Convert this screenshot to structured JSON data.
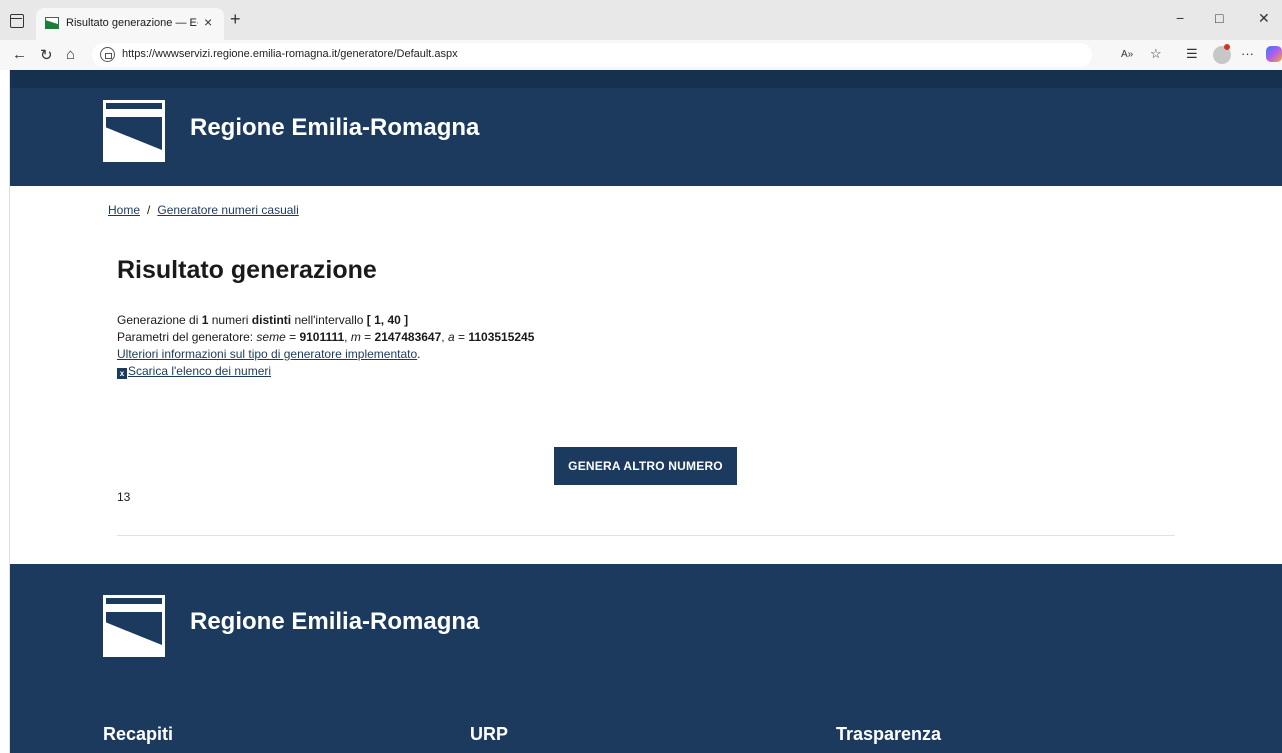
{
  "browser": {
    "tab_title": "Risultato generazione — E-R Il po",
    "tab_close": "×",
    "new_tab": "+",
    "url": "https://wwwservizi.regione.emilia-romagna.it/generatore/Default.aspx",
    "window_controls": {
      "minimize": "−",
      "maximize": "□",
      "close": "✕"
    },
    "nav_icons": {
      "back": "←",
      "refresh": "↻",
      "home": "⌂"
    },
    "toolbar_icons": {
      "read_aloud": "A»",
      "favorite": "☆",
      "collections": "☰",
      "more": "···"
    }
  },
  "header": {
    "brand": "Regione Emilia-Romagna"
  },
  "breadcrumb": {
    "home": "Home",
    "separator": "/",
    "current": "Generatore numeri casuali"
  },
  "main": {
    "title": "Risultato generazione",
    "line1": {
      "prefix": "Generazione di ",
      "count": "1",
      "mid1": " numeri ",
      "type": "distinti",
      "mid2": " nell'intervallo ",
      "range": "[ 1, 40 ]"
    },
    "line2": {
      "prefix": "Parametri del generatore: ",
      "seed_label": "seme",
      "eq": " = ",
      "seed": "9101111",
      "sep1": ", ",
      "m_label": "m",
      "m": "2147483647",
      "sep2": ", ",
      "a_label": "a",
      "a": "1103515245"
    },
    "more_info_link": "Ulteriori informazioni sul tipo di generatore implementato",
    "more_info_dot": ".",
    "download_icon": "x",
    "download_link": "Scarica l'elenco dei numeri",
    "generate_button": "GENERA ALTRO NUMERO",
    "result": "13"
  },
  "footer": {
    "brand": "Regione Emilia-Romagna",
    "columns": [
      "Recapiti",
      "URP",
      "Trasparenza"
    ]
  },
  "colors": {
    "brand_blue": "#1b3a5e",
    "white": "#ffffff"
  }
}
